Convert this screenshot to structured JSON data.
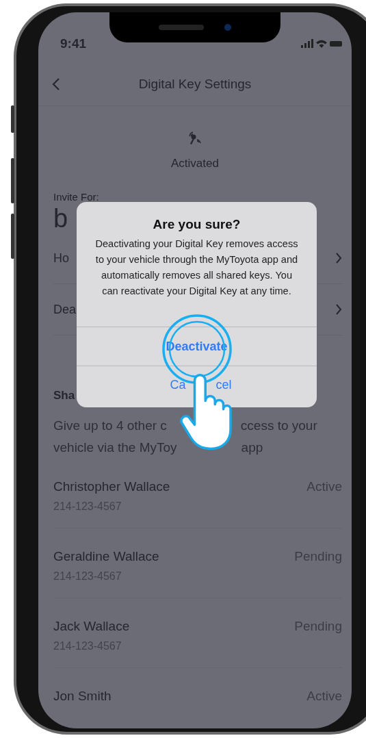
{
  "status_bar": {
    "time": "9:41"
  },
  "header": {
    "title": "Digital Key Settings"
  },
  "key_status": {
    "label": "Activated"
  },
  "invite": {
    "label": "Invite For:",
    "vehicle": "b"
  },
  "menu_rows": [
    {
      "label": "Ho"
    },
    {
      "label": "Dea"
    }
  ],
  "share_section": {
    "heading": "Sha",
    "description_lines": [
      [
        "Give up to 4 other c",
        "ccess to your"
      ],
      [
        "vehicle via the MyToy",
        "app"
      ]
    ]
  },
  "drivers": [
    {
      "name": "Christopher Wallace",
      "phone": "214-123-4567",
      "status": "Active"
    },
    {
      "name": "Geraldine Wallace",
      "phone": "214-123-4567",
      "status": "Pending"
    },
    {
      "name": "Jack Wallace",
      "phone": "214-123-4567",
      "status": "Pending"
    },
    {
      "name": "Jon Smith",
      "status": "Active"
    }
  ],
  "dialog": {
    "title": "Are you sure?",
    "message": "Deactivating your Digital Key removes access to your vehicle through the MyToyota app and automatically removes all shared keys. You can reactivate your Digital Key at any time.",
    "buttons": [
      {
        "kind": "primary",
        "label_parts": [
          "Deactivate"
        ]
      },
      {
        "kind": "cancel",
        "label_parts": [
          "Ca",
          "cel"
        ]
      }
    ]
  }
}
